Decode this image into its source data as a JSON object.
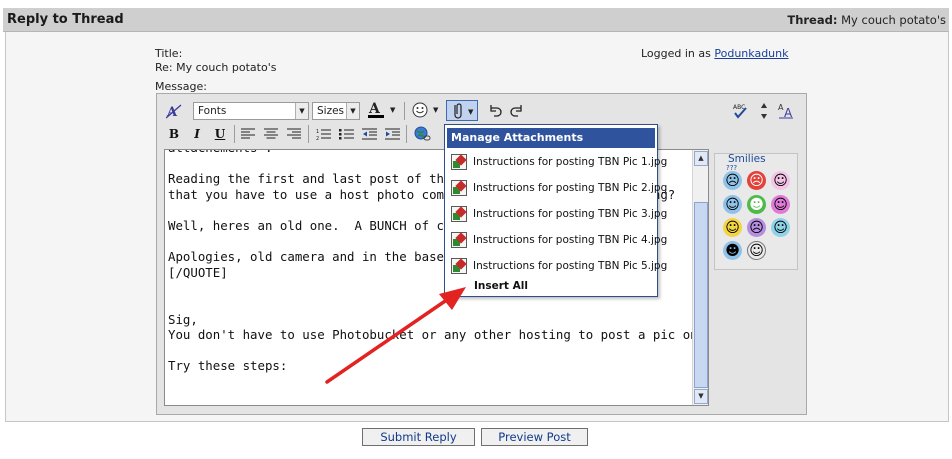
{
  "header": {
    "title": "Reply to Thread",
    "thread_label": "Thread:",
    "thread_value": "My couch potato's"
  },
  "form": {
    "title_label": "Title:",
    "title_value": "Re: My couch potato's",
    "logged_in_prefix": "Logged in as",
    "username": "Podunkadunk",
    "message_label": "Message:"
  },
  "toolbar": {
    "font_select": "Fonts",
    "size_select": "Sizes",
    "icons": [
      "switch-mode-icon",
      "font-color-icon",
      "smiley-icon",
      "attachment-icon",
      "undo-icon",
      "redo-icon",
      "spellcheck-icon",
      "resize-icon",
      "text-size-icon",
      "bold-icon",
      "italic-icon",
      "underline-icon",
      "align-left-icon",
      "align-center-icon",
      "align-right-icon",
      "ordered-list-icon",
      "unordered-list-icon",
      "outdent-icon",
      "indent-icon",
      "link-icon"
    ],
    "bold": "B",
    "italic": "I",
    "underline": "U"
  },
  "message": {
    "lines": [
      "attachements .",
      "",
      "Reading the first and last post of the \"how                   ned",
      "that you have to use a host photo compa                          ng?",
      "",
      "Well, heres an old one.  A BUNCH of couc",
      "",
      "Apologies, old camera and in the basemen",
      "[/QUOTE]",
      "",
      "",
      "Sig,",
      "You don't have to use Photobucket or any other hosting to post a pic on TBN.",
      "",
      "Try these steps:"
    ]
  },
  "attachments": {
    "title": "Manage Attachments",
    "items": [
      "Instructions for posting TBN Pic 1.jpg",
      "Instructions for posting TBN Pic 2.jpg",
      "Instructions for posting TBN Pic 3.jpg",
      "Instructions for posting TBN Pic 4.jpg",
      "Instructions for posting TBN Pic 5.jpg"
    ],
    "insert_all": "Insert All"
  },
  "smilies": {
    "title": "Smilies",
    "caption": "???"
  },
  "buttons": {
    "submit": "Submit Reply",
    "preview": "Preview Post"
  },
  "colors": {
    "header_bg": "#cfcfcf",
    "popup_header": "#2f539c",
    "link": "#1a3f9a",
    "arrow": "#e32222"
  }
}
